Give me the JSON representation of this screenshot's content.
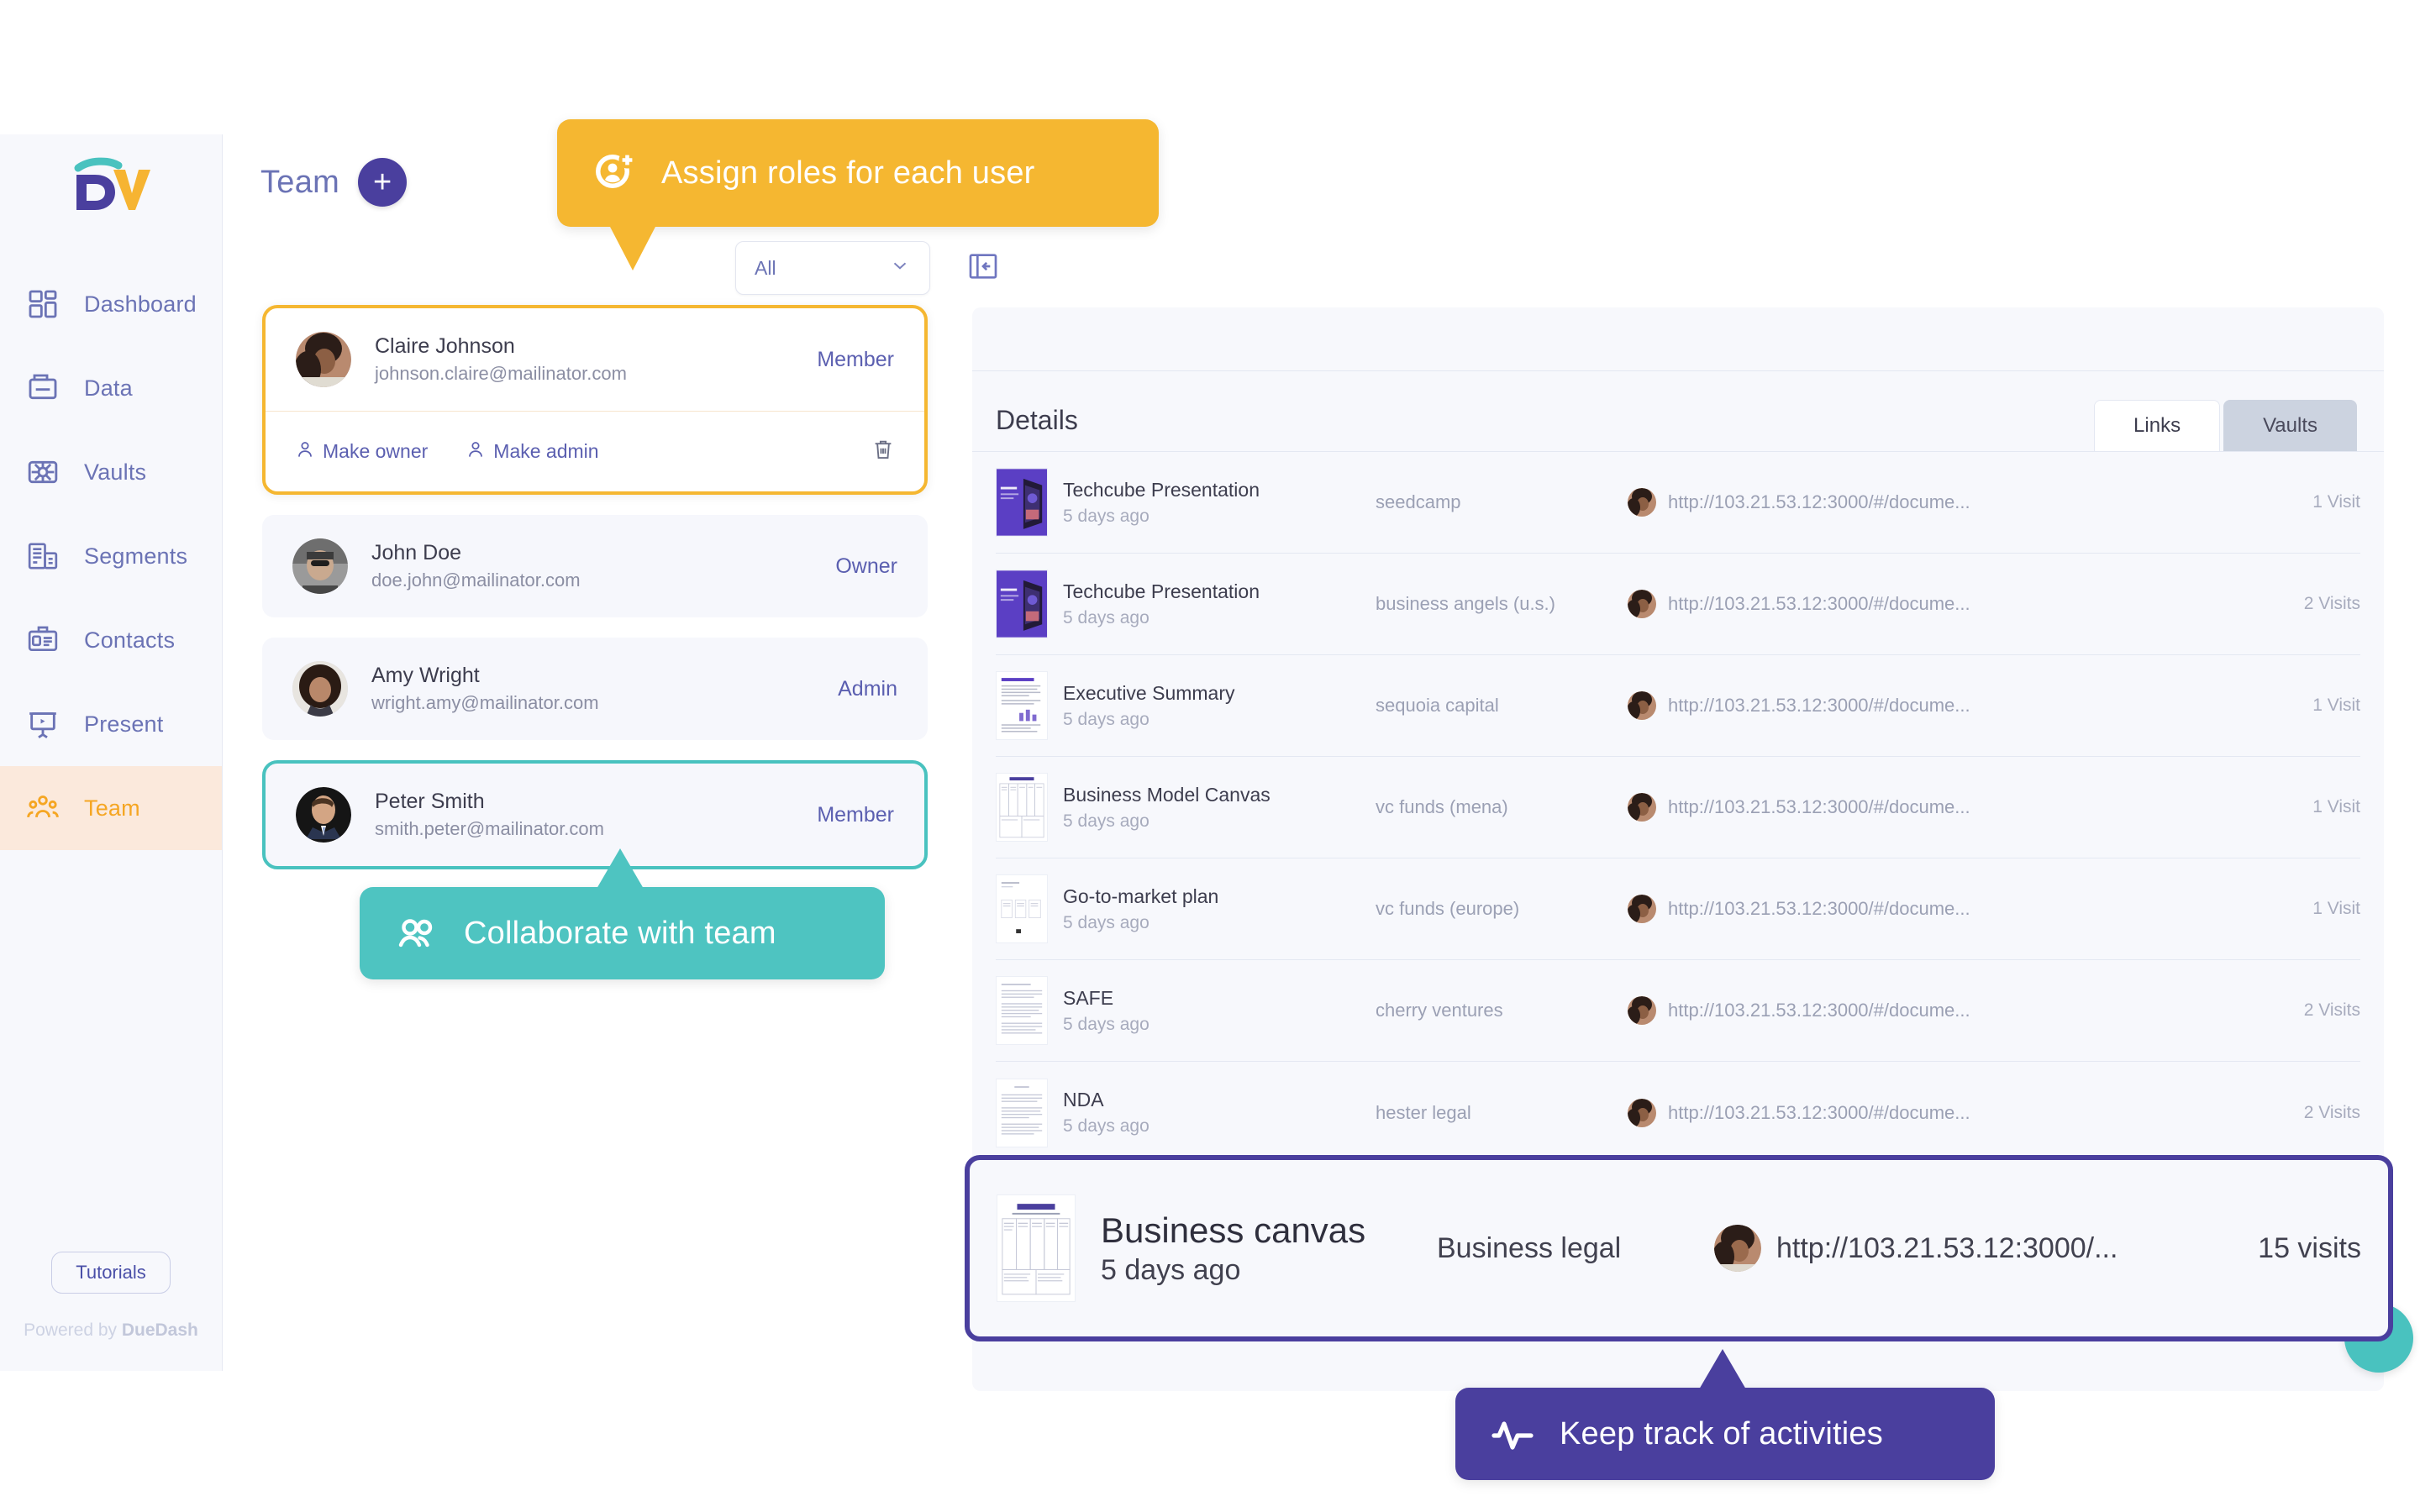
{
  "brand": {
    "logo_text": "DV",
    "colors": {
      "purple": "#4a3f9e",
      "teal": "#49c2bf",
      "amber": "#f5b731",
      "nav_text": "#6b73b5",
      "panel_bg": "#f7f8fc"
    }
  },
  "sidebar": {
    "items": [
      {
        "label": "Dashboard",
        "icon": "dashboard-icon",
        "active": false
      },
      {
        "label": "Data",
        "icon": "data-icon",
        "active": false
      },
      {
        "label": "Vaults",
        "icon": "vault-icon",
        "active": false
      },
      {
        "label": "Segments",
        "icon": "segments-icon",
        "active": false
      },
      {
        "label": "Contacts",
        "icon": "contacts-icon",
        "active": false
      },
      {
        "label": "Present",
        "icon": "present-icon",
        "active": false
      },
      {
        "label": "Team",
        "icon": "team-icon",
        "active": true
      }
    ],
    "tutorials_label": "Tutorials",
    "powered_by_prefix": "Powered by ",
    "powered_by_brand": "DueDash"
  },
  "team": {
    "title": "Team",
    "add_button_label": "+",
    "filter": {
      "value": "All",
      "placeholder": "All",
      "chevron": "chevron-down-icon"
    },
    "collapse_icon": "collapse-panel-icon",
    "members": [
      {
        "name": "Claire Johnson",
        "email": "johnson.claire@mailinator.com",
        "role": "Member",
        "highlight": "amber",
        "expanded": true,
        "actions": [
          {
            "label": "Make owner",
            "icon": "user-icon"
          },
          {
            "label": "Make admin",
            "icon": "user-icon"
          }
        ],
        "delete_icon": "trash-icon"
      },
      {
        "name": "John Doe",
        "email": "doe.john@mailinator.com",
        "role": "Owner",
        "highlight": "none",
        "expanded": false
      },
      {
        "name": "Amy Wright",
        "email": "wright.amy@mailinator.com",
        "role": "Admin",
        "highlight": "none",
        "expanded": false
      },
      {
        "name": "Peter Smith",
        "email": "smith.peter@mailinator.com",
        "role": "Member",
        "highlight": "teal",
        "expanded": false
      }
    ]
  },
  "details": {
    "title": "Details",
    "tabs": [
      {
        "label": "Links",
        "active": true
      },
      {
        "label": "Vaults",
        "active": false
      }
    ],
    "rows": [
      {
        "doc": "Techcube Presentation",
        "date": "5 days ago",
        "segment": "seedcamp",
        "url": "http://103.21.53.12:3000/#/docume...",
        "visits": "1 Visit",
        "thumb": "techcube-thumb"
      },
      {
        "doc": "Techcube Presentation",
        "date": "5 days ago",
        "segment": "business angels (u.s.)",
        "url": "http://103.21.53.12:3000/#/docume...",
        "visits": "2 Visits",
        "thumb": "techcube-thumb"
      },
      {
        "doc": "Executive Summary",
        "date": "5 days ago",
        "segment": "sequoia capital",
        "url": "http://103.21.53.12:3000/#/docume...",
        "visits": "1 Visit",
        "thumb": "document-thumb"
      },
      {
        "doc": "Business Model Canvas",
        "date": "5 days ago",
        "segment": "vc funds (mena)",
        "url": "http://103.21.53.12:3000/#/docume...",
        "visits": "1 Visit",
        "thumb": "canvas-thumb"
      },
      {
        "doc": "Go-to-market plan",
        "date": "5 days ago",
        "segment": "vc funds (europe)",
        "url": "http://103.21.53.12:3000/#/docume...",
        "visits": "1 Visit",
        "thumb": "plan-thumb"
      },
      {
        "doc": "SAFE",
        "date": "5 days ago",
        "segment": "cherry ventures",
        "url": "http://103.21.53.12:3000/#/docume...",
        "visits": "2 Visits",
        "thumb": "text-thumb"
      },
      {
        "doc": "NDA",
        "date": "5 days ago",
        "segment": "hester legal",
        "url": "http://103.21.53.12:3000/#/docume...",
        "visits": "2 Visits",
        "thumb": "text-thumb"
      }
    ],
    "highlighted_row": {
      "doc": "Business canvas",
      "date": "5 days ago",
      "segment": "Business legal",
      "url": "http://103.21.53.12:3000/...",
      "visits": "15 visits",
      "thumb": "canvas-thumb"
    }
  },
  "callouts": [
    {
      "id": "assign",
      "text": "Assign roles for each user",
      "icon": "assign-role-icon",
      "color": "#f5b731"
    },
    {
      "id": "collab",
      "text": "Collaborate with team",
      "icon": "team-people-icon",
      "color": "#4ec4c1"
    },
    {
      "id": "track",
      "text": "Keep track of activities",
      "icon": "activity-pulse-icon",
      "color": "#4a3f9e"
    }
  ],
  "fab": {
    "icon": "help-chat-fab",
    "color": "#49c2bf"
  }
}
